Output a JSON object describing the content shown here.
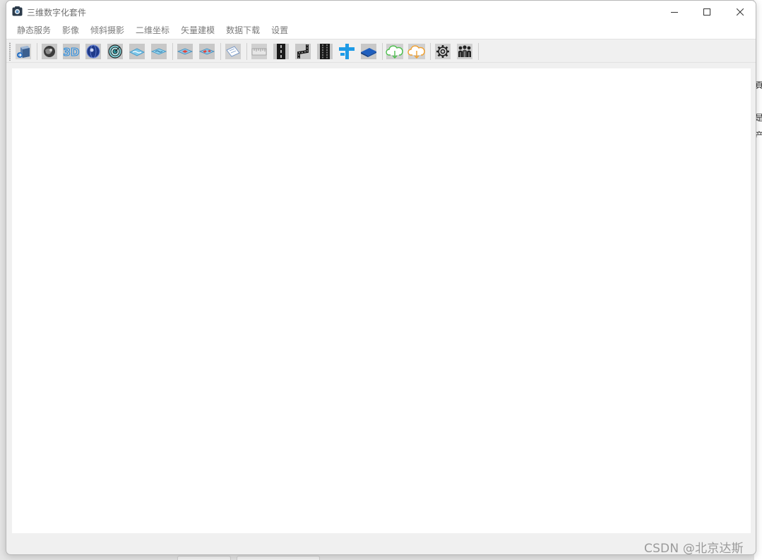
{
  "window": {
    "title": "三维数字化套件",
    "controls": [
      "minimize-icon",
      "maximize-icon",
      "close-icon"
    ]
  },
  "menu": [
    {
      "label": "静态服务"
    },
    {
      "label": "影像"
    },
    {
      "label": "倾斜摄影"
    },
    {
      "label": "二维坐标"
    },
    {
      "label": "矢量建模"
    },
    {
      "label": "数据下载"
    },
    {
      "label": "设置"
    }
  ],
  "toolbar": {
    "tools": [
      {
        "icon": "cube-export-icon"
      },
      {
        "icon": "terrain-sphere-icon"
      },
      {
        "icon": "3d-text-icon",
        "text": "3D"
      },
      {
        "icon": "globe-icon"
      },
      {
        "icon": "radar-target-icon"
      },
      {
        "icon": "water-layer-icon"
      },
      {
        "icon": "water-layer-alt-icon"
      },
      {
        "icon": "layer-red-icon"
      },
      {
        "icon": "layer-red-alt-icon"
      },
      {
        "icon": "document-edit-icon"
      },
      {
        "icon": "ruler-icon"
      },
      {
        "icon": "road-vertical-icon"
      },
      {
        "icon": "road-curve-icon"
      },
      {
        "icon": "road-dashed-icon"
      },
      {
        "icon": "pipe-tee-icon"
      },
      {
        "icon": "blue-plane-icon"
      },
      {
        "icon": "cloud-download-green-icon"
      },
      {
        "icon": "cloud-download-orange-icon"
      },
      {
        "icon": "gear-icon"
      },
      {
        "icon": "users-group-icon"
      }
    ]
  },
  "background": {
    "right_chars": [
      "頁",
      "是",
      "产"
    ]
  },
  "watermark": "CSDN @北京达斯"
}
